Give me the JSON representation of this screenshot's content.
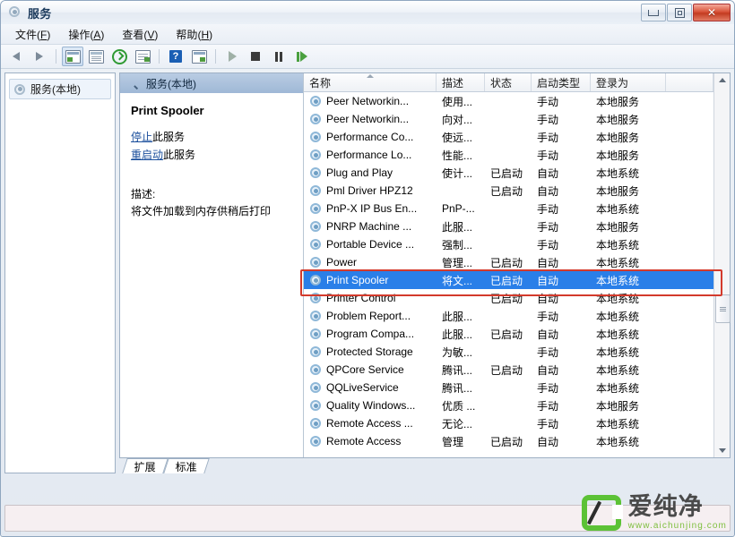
{
  "window": {
    "title": "服务",
    "icon": "services-gear-icon",
    "buttons": {
      "minimize": "最小化",
      "maximize": "最大化",
      "close": "关闭"
    }
  },
  "menubar": [
    {
      "label": "文件",
      "accel": "F"
    },
    {
      "label": "操作",
      "accel": "A"
    },
    {
      "label": "查看",
      "accel": "V"
    },
    {
      "label": "帮助",
      "accel": "H"
    }
  ],
  "toolbar": [
    {
      "name": "back-icon",
      "label": "后退"
    },
    {
      "name": "forward-icon",
      "label": "前进"
    },
    {
      "name": "show-hide-tree-icon",
      "label": "显示/隐藏控制台树"
    },
    {
      "name": "properties-icon",
      "label": "属性"
    },
    {
      "name": "refresh-icon",
      "label": "刷新"
    },
    {
      "name": "export-list-icon",
      "label": "导出列表"
    },
    {
      "name": "help-icon",
      "label": "帮助"
    },
    {
      "name": "show-action-pane-icon",
      "label": "显示操作窗格"
    },
    {
      "name": "start-service-icon",
      "label": "启动服务"
    },
    {
      "name": "stop-service-icon",
      "label": "停止服务"
    },
    {
      "name": "pause-service-icon",
      "label": "暂停服务"
    },
    {
      "name": "restart-service-icon",
      "label": "重启动服务"
    }
  ],
  "tree": {
    "items": [
      {
        "label": "服务(本地)",
        "icon": "services-gear-icon",
        "selected": true
      }
    ]
  },
  "detail": {
    "header": "服务(本地)",
    "header_icon": "magnifier-icon",
    "service_name": "Print Spooler",
    "links": [
      {
        "link_text": "停止",
        "suffix": "此服务"
      },
      {
        "link_text": "重启动",
        "suffix": "此服务"
      }
    ],
    "description_label": "描述:",
    "description_text": "将文件加载到内存供稍后打印"
  },
  "list": {
    "columns": [
      {
        "key": "name",
        "label": "名称",
        "sorted": true,
        "sort_dir": "asc"
      },
      {
        "key": "description",
        "label": "描述"
      },
      {
        "key": "status",
        "label": "状态"
      },
      {
        "key": "startup",
        "label": "启动类型"
      },
      {
        "key": "logon",
        "label": "登录为"
      },
      {
        "key": "tail",
        "label": ""
      }
    ],
    "rows": [
      {
        "name": "Peer Networkin...",
        "description": "使用...",
        "status": "",
        "startup": "手动",
        "logon": "本地服务",
        "selected": false
      },
      {
        "name": "Peer Networkin...",
        "description": "向对...",
        "status": "",
        "startup": "手动",
        "logon": "本地服务",
        "selected": false
      },
      {
        "name": "Performance Co...",
        "description": "使远...",
        "status": "",
        "startup": "手动",
        "logon": "本地服务",
        "selected": false
      },
      {
        "name": "Performance Lo...",
        "description": "性能...",
        "status": "",
        "startup": "手动",
        "logon": "本地服务",
        "selected": false
      },
      {
        "name": "Plug and Play",
        "description": "使计...",
        "status": "已启动",
        "startup": "自动",
        "logon": "本地系统",
        "selected": false
      },
      {
        "name": "Pml Driver HPZ12",
        "description": "",
        "status": "已启动",
        "startup": "自动",
        "logon": "本地服务",
        "selected": false
      },
      {
        "name": "PnP-X IP Bus En...",
        "description": "PnP-...",
        "status": "",
        "startup": "手动",
        "logon": "本地系统",
        "selected": false
      },
      {
        "name": "PNRP Machine ...",
        "description": "此服...",
        "status": "",
        "startup": "手动",
        "logon": "本地服务",
        "selected": false
      },
      {
        "name": "Portable Device ...",
        "description": "强制...",
        "status": "",
        "startup": "手动",
        "logon": "本地系统",
        "selected": false
      },
      {
        "name": "Power",
        "description": "管理...",
        "status": "已启动",
        "startup": "自动",
        "logon": "本地系统",
        "selected": false
      },
      {
        "name": "Print Spooler",
        "description": "将文...",
        "status": "已启动",
        "startup": "自动",
        "logon": "本地系统",
        "selected": true
      },
      {
        "name": "Printer Control",
        "description": "",
        "status": "已启动",
        "startup": "自动",
        "logon": "本地系统",
        "selected": false
      },
      {
        "name": "Problem Report...",
        "description": "此服...",
        "status": "",
        "startup": "手动",
        "logon": "本地系统",
        "selected": false
      },
      {
        "name": "Program Compa...",
        "description": "此服...",
        "status": "已启动",
        "startup": "自动",
        "logon": "本地系统",
        "selected": false
      },
      {
        "name": "Protected Storage",
        "description": "为敏...",
        "status": "",
        "startup": "手动",
        "logon": "本地系统",
        "selected": false
      },
      {
        "name": "QPCore Service",
        "description": "腾讯...",
        "status": "已启动",
        "startup": "自动",
        "logon": "本地系统",
        "selected": false
      },
      {
        "name": "QQLiveService",
        "description": "腾讯...",
        "status": "",
        "startup": "手动",
        "logon": "本地系统",
        "selected": false
      },
      {
        "name": "Quality Windows...",
        "description": "优质 ...",
        "status": "",
        "startup": "手动",
        "logon": "本地服务",
        "selected": false
      },
      {
        "name": "Remote Access ...",
        "description": "无论...",
        "status": "",
        "startup": "手动",
        "logon": "本地系统",
        "selected": false
      },
      {
        "name": "Remote Access",
        "description": "管理",
        "status": "已启动",
        "startup": "自动",
        "logon": "本地系统",
        "selected": false
      }
    ]
  },
  "tabs": [
    {
      "label": "扩展",
      "active": false
    },
    {
      "label": "标准",
      "active": true
    }
  ],
  "watermark": {
    "brand": "爱纯净",
    "url": "www.aichunjing.com"
  },
  "colors": {
    "selection": "#2a7fe8",
    "annotation": "#d33a2c",
    "link": "#1b4f9c",
    "brand_green": "#5cc236"
  }
}
